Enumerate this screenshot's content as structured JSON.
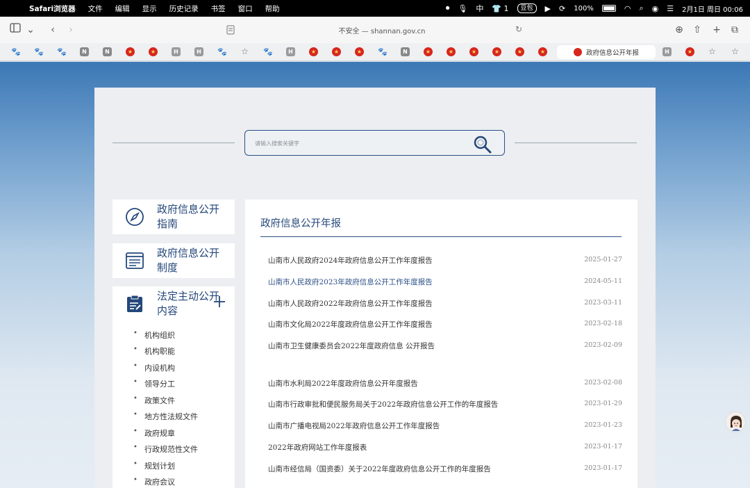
{
  "menubar": {
    "items": [
      "Safari浏览器",
      "文件",
      "编辑",
      "显示",
      "历史记录",
      "书签",
      "窗口",
      "帮助"
    ],
    "status_pill": "豆包",
    "wechat_count": "1",
    "battery": "100%",
    "datetime": "2月1日 周日 00:06"
  },
  "toolbar": {
    "url": "不安全 — shannan.gov.cn"
  },
  "favorites": {
    "active_tab": "政府信息公开年报"
  },
  "search": {
    "placeholder": "请输入搜索关键字"
  },
  "sidebar": {
    "cards": [
      {
        "label": "政府信息公开指南"
      },
      {
        "label": "政府信息公开制度"
      },
      {
        "label": "法定主动公开内容"
      }
    ],
    "subitems": [
      "机构组织",
      "机构职能",
      "内设机构",
      "领导分工",
      "政策文件",
      "地方性法规文件",
      "政府规章",
      "行政规范性文件",
      "规划计划",
      "政府会议"
    ]
  },
  "main": {
    "title": "政府信息公开年报",
    "rows": [
      {
        "title": "山南市人民政府2024年政府信息公开工作年度报告",
        "date": "2025-01-27"
      },
      {
        "title": "山南市人民政府2023年政府信息公开工作年度报告",
        "date": "2024-05-11"
      },
      {
        "title": "山南市人民政府2022年政府信息公开工作年度报告",
        "date": "2023-03-11"
      },
      {
        "title": "山南市文化局2022年度政府信息公开工作年度报告",
        "date": "2023-02-18"
      },
      {
        "title": "山南市卫生健康委员会2022年度政府信息 公开报告",
        "date": "2023-02-09"
      },
      {
        "title": "山南市水利局2022年度政府信息公开年度报告",
        "date": "2023-02-08"
      },
      {
        "title": "山南市行政审批和便民服务局关于2022年政府信息公开工作的年度报告",
        "date": "2023-01-29"
      },
      {
        "title": "山南市广播电视局2022年政府信息公开工作年度报告",
        "date": "2023-01-23"
      },
      {
        "title": "2022年政府网站工作年度报表",
        "date": "2023-01-17"
      },
      {
        "title": "山南市经信局（国资委）关于2022年度政府信息公开工作的年度报告",
        "date": "2023-01-17"
      }
    ]
  },
  "colors": {
    "accent": "#24477a",
    "search_border": "#2a4f86"
  }
}
